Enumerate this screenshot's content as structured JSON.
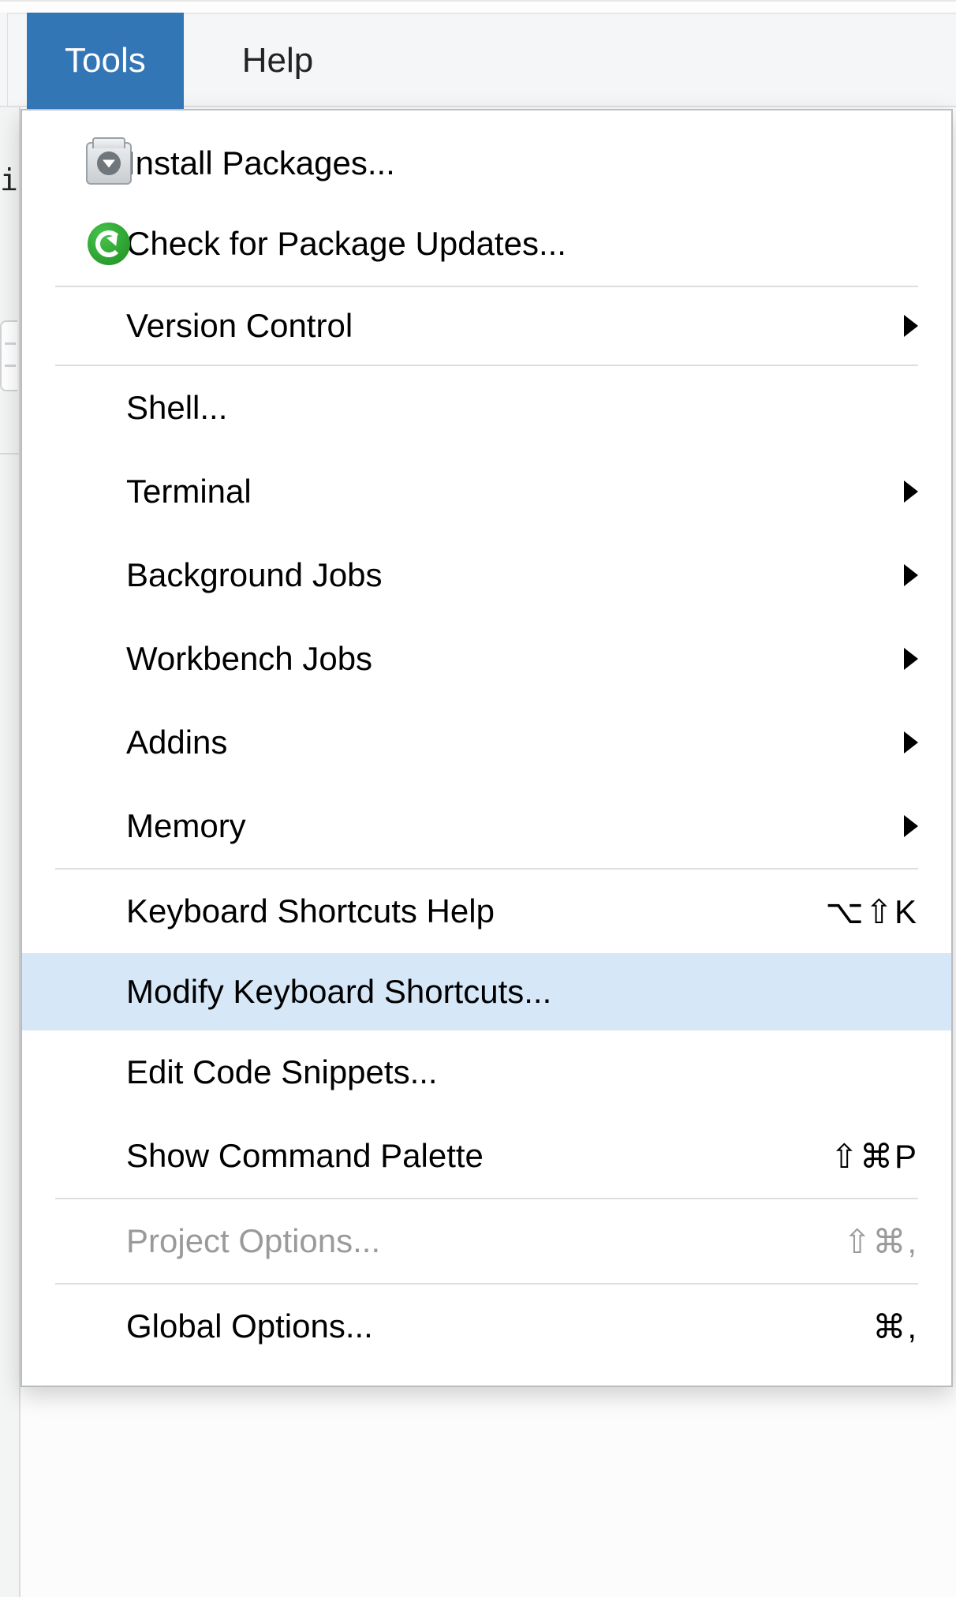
{
  "menubar": {
    "tools_label": "Tools",
    "help_label": "Help"
  },
  "gutter": {
    "fragment": "i"
  },
  "menu": {
    "install_packages": "Install Packages...",
    "check_updates": "Check for Package Updates...",
    "version_control": "Version Control",
    "shell": "Shell...",
    "terminal": "Terminal",
    "background_jobs": "Background Jobs",
    "workbench_jobs": "Workbench Jobs",
    "addins": "Addins",
    "memory": "Memory",
    "kb_shortcuts_help": "Keyboard Shortcuts Help",
    "kb_shortcuts_help_sc": "⌥⇧K",
    "modify_kb_shortcuts": "Modify Keyboard Shortcuts...",
    "edit_snippets": "Edit Code Snippets...",
    "show_cmd_palette": "Show Command Palette",
    "show_cmd_palette_sc": "⇧⌘P",
    "project_options": "Project Options...",
    "project_options_sc": "⇧⌘,",
    "global_options": "Global Options...",
    "global_options_sc": "⌘,"
  }
}
